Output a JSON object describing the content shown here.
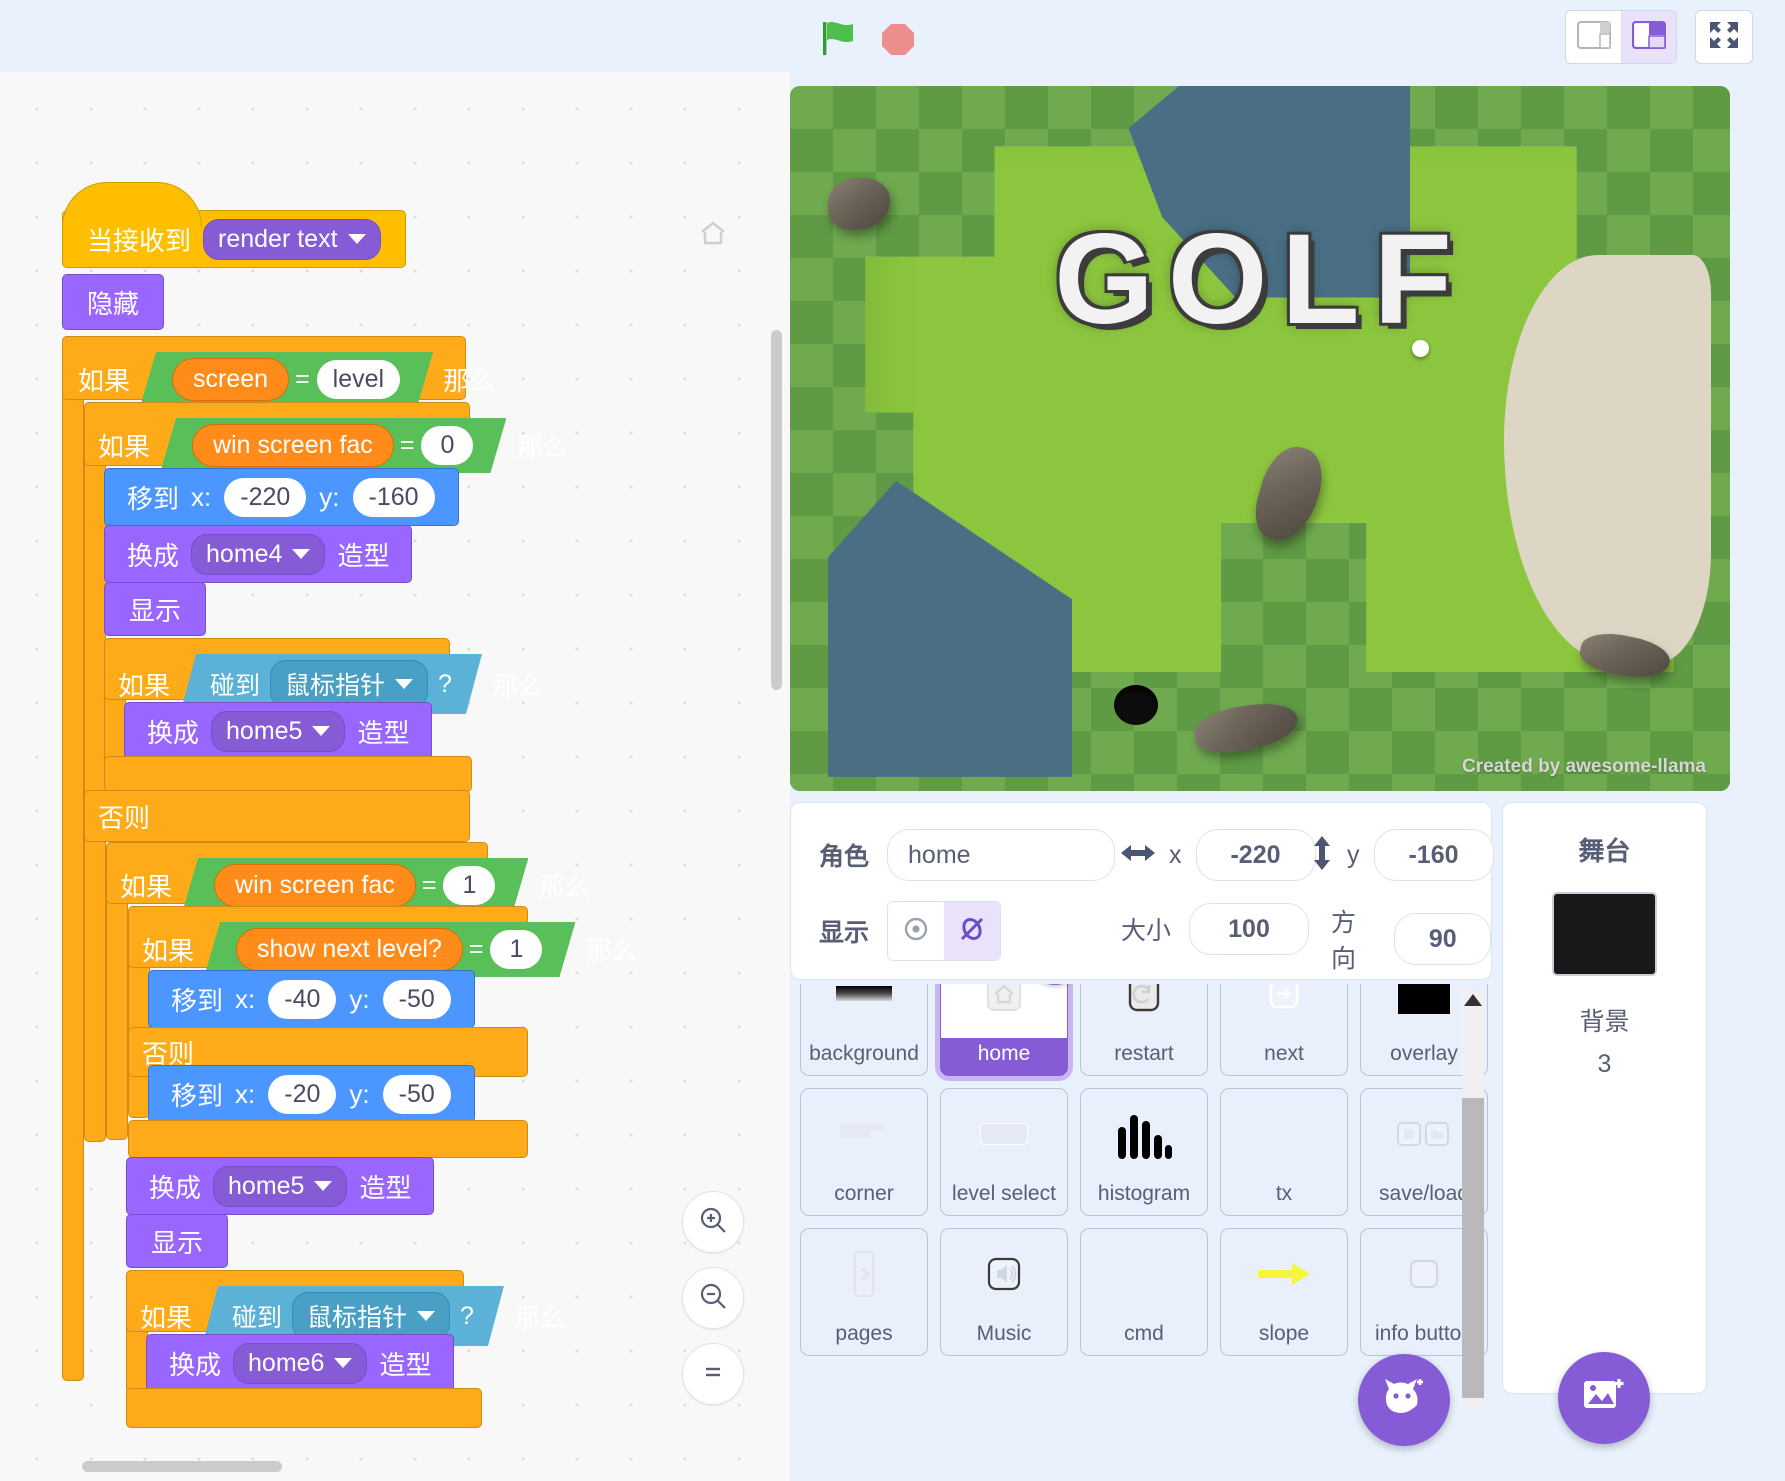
{
  "toolbar": {
    "green_flag_icon": "green-flag-icon",
    "stop_icon": "stop-sign-icon",
    "small_stage_icon": "small-stage-layout-icon",
    "large_stage_icon": "large-stage-layout-icon",
    "fullscreen_icon": "fullscreen-icon"
  },
  "code_area": {
    "home_icon": "home-icon",
    "zoom_in_icon": "zoom-in-icon",
    "zoom_out_icon": "zoom-out-icon",
    "zoom_reset_icon": "zoom-reset-icon",
    "blocks": {
      "b1_when_receive": "当接收到",
      "b1_message": "render text",
      "b2_hide": "隐藏",
      "b3_if": "如果",
      "b3_then": "那么",
      "b3_var": "screen",
      "b3_eq": "=",
      "b3_val": "level",
      "b4_if": "如果",
      "b4_then": "那么",
      "b4_var": "win screen fac",
      "b4_eq": "=",
      "b4_val": "0",
      "b5_goto": "移到",
      "b5_xlabel": "x:",
      "b5_x": "-220",
      "b5_ylabel": "y:",
      "b5_y": "-160",
      "b6_switch": "换成",
      "b6_costume": "home4",
      "b6_suffix": "造型",
      "b7_show": "显示",
      "b8_if": "如果",
      "b8_then": "那么",
      "b8_touching": "碰到",
      "b8_target": "鼠标指针",
      "b8_q": "?",
      "b9_switch": "换成",
      "b9_costume": "home5",
      "b9_suffix": "造型",
      "b10_else": "否则",
      "b11_if": "如果",
      "b11_then": "那么",
      "b11_var": "win screen fac",
      "b11_eq": "=",
      "b11_val": "1",
      "b12_if": "如果",
      "b12_then": "那么",
      "b12_var": "show next level?",
      "b12_eq": "=",
      "b12_val": "1",
      "b13_goto": "移到",
      "b13_xlabel": "x:",
      "b13_x": "-40",
      "b13_ylabel": "y:",
      "b13_y": "-50",
      "b14_else": "否则",
      "b15_goto": "移到",
      "b15_xlabel": "x:",
      "b15_x": "-20",
      "b15_ylabel": "y:",
      "b15_y": "-50",
      "b16_switch": "换成",
      "b16_costume": "home5",
      "b16_suffix": "造型",
      "b17_show": "显示",
      "b18_if": "如果",
      "b18_then": "那么",
      "b18_touching": "碰到",
      "b18_target": "鼠标指针",
      "b18_q": "?",
      "b19_switch": "换成",
      "b19_costume": "home6",
      "b19_suffix": "造型"
    }
  },
  "stage": {
    "title_text": "GOLF",
    "credit": "Created by awesome-llama"
  },
  "sprite_info": {
    "sprite_label": "角色",
    "sprite_name": "home",
    "x_label": "x",
    "x_value": "-220",
    "y_label": "y",
    "y_value": "-160",
    "show_label": "显示",
    "show_icon": "eye-icon",
    "hide_icon": "eye-slash-icon",
    "size_label": "大小",
    "size_value": "100",
    "direction_label": "方向",
    "direction_value": "90",
    "x_arrow_icon": "horizontal-arrow-icon",
    "y_arrow_icon": "vertical-arrow-icon"
  },
  "sprites": [
    {
      "name": "background",
      "icon": "gradient-bar-icon",
      "selected": false
    },
    {
      "name": "home",
      "icon": "home-thumb-icon",
      "selected": true
    },
    {
      "name": "restart",
      "icon": "restart-arrow-icon",
      "selected": false
    },
    {
      "name": "next",
      "icon": "next-arrow-icon",
      "selected": false
    },
    {
      "name": "overlay",
      "icon": "black-square-icon",
      "selected": false
    },
    {
      "name": "corner",
      "icon": "corner-shape-icon",
      "selected": false
    },
    {
      "name": "level select",
      "icon": "rounded-rect-icon",
      "selected": false
    },
    {
      "name": "histogram",
      "icon": "histogram-bars-icon",
      "selected": false
    },
    {
      "name": "tx",
      "icon": "blank-icon",
      "selected": false
    },
    {
      "name": "save/load",
      "icon": "save-load-icon",
      "selected": false
    },
    {
      "name": "pages",
      "icon": "page-arrow-icon",
      "selected": false
    },
    {
      "name": "Music",
      "icon": "speaker-icon",
      "selected": false
    },
    {
      "name": "cmd",
      "icon": "blank-icon",
      "selected": false
    },
    {
      "name": "slope",
      "icon": "yellow-arrow-icon",
      "selected": false
    },
    {
      "name": "info button",
      "icon": "info-button-icon",
      "selected": false
    }
  ],
  "sprite_actions": {
    "delete_icon": "trash-icon",
    "add_sprite_icon": "add-sprite-cat-icon"
  },
  "stage_panel": {
    "title": "舞台",
    "backdrops_label": "背景",
    "backdrops_count": "3",
    "add_backdrop_icon": "add-backdrop-icon"
  }
}
